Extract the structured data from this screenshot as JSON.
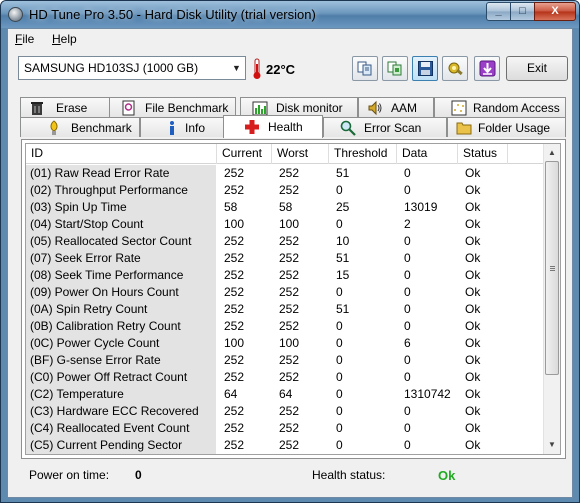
{
  "window": {
    "title": "HD Tune Pro 3.50 - Hard Disk Utility (trial version)",
    "minimize_label": "_",
    "maximize_label": "□",
    "close_label": "X"
  },
  "menu": {
    "file": {
      "underlined": "F",
      "rest": "ile"
    },
    "help": {
      "underlined": "H",
      "rest": "elp"
    }
  },
  "toolbar": {
    "drive": "SAMSUNG HD103SJ (1000 GB)",
    "temperature": "22°C",
    "exit_label": "Exit"
  },
  "tabs_top": [
    {
      "label": "Erase",
      "icon": "trash-icon"
    },
    {
      "label": "File Benchmark",
      "icon": "file-benchmark-icon"
    },
    {
      "label": "Disk monitor",
      "icon": "disk-monitor-icon"
    },
    {
      "label": "AAM",
      "icon": "speaker-icon"
    },
    {
      "label": "Random Access",
      "icon": "random-access-icon"
    }
  ],
  "tabs_bottom": [
    {
      "label": "Benchmark",
      "icon": "benchmark-icon"
    },
    {
      "label": "Info",
      "icon": "info-icon"
    },
    {
      "label": "Health",
      "icon": "health-cross-icon",
      "selected": true
    },
    {
      "label": "Error Scan",
      "icon": "magnifier-icon"
    },
    {
      "label": "Folder Usage",
      "icon": "folder-icon"
    }
  ],
  "table": {
    "columns": [
      "ID",
      "Current",
      "Worst",
      "Threshold",
      "Data",
      "Status"
    ],
    "rows": [
      [
        "(01) Raw Read Error Rate",
        "252",
        "252",
        "51",
        "0",
        "Ok"
      ],
      [
        "(02) Throughput Performance",
        "252",
        "252",
        "0",
        "0",
        "Ok"
      ],
      [
        "(03) Spin Up Time",
        "58",
        "58",
        "25",
        "13019",
        "Ok"
      ],
      [
        "(04) Start/Stop Count",
        "100",
        "100",
        "0",
        "2",
        "Ok"
      ],
      [
        "(05) Reallocated Sector Count",
        "252",
        "252",
        "10",
        "0",
        "Ok"
      ],
      [
        "(07) Seek Error Rate",
        "252",
        "252",
        "51",
        "0",
        "Ok"
      ],
      [
        "(08) Seek Time Performance",
        "252",
        "252",
        "15",
        "0",
        "Ok"
      ],
      [
        "(09) Power On Hours Count",
        "252",
        "252",
        "0",
        "0",
        "Ok"
      ],
      [
        "(0A) Spin Retry Count",
        "252",
        "252",
        "51",
        "0",
        "Ok"
      ],
      [
        "(0B) Calibration Retry Count",
        "252",
        "252",
        "0",
        "0",
        "Ok"
      ],
      [
        "(0C) Power Cycle Count",
        "100",
        "100",
        "0",
        "6",
        "Ok"
      ],
      [
        "(BF) G-sense Error Rate",
        "252",
        "252",
        "0",
        "0",
        "Ok"
      ],
      [
        "(C0) Power Off Retract Count",
        "252",
        "252",
        "0",
        "0",
        "Ok"
      ],
      [
        "(C2) Temperature",
        "64",
        "64",
        "0",
        "1310742",
        "Ok"
      ],
      [
        "(C3) Hardware ECC Recovered",
        "252",
        "252",
        "0",
        "0",
        "Ok"
      ],
      [
        "(C4) Reallocated Event Count",
        "252",
        "252",
        "0",
        "0",
        "Ok"
      ],
      [
        "(C5) Current Pending Sector",
        "252",
        "252",
        "0",
        "0",
        "Ok"
      ]
    ]
  },
  "status_bar": {
    "power_on_label": "Power on time:",
    "power_on_value": "0",
    "health_label": "Health status:",
    "health_value": "Ok"
  },
  "colors": {
    "health_ok": "#22aa22",
    "title_bar": "#6c97bd",
    "id_column_bg": "#e3e3e3"
  }
}
